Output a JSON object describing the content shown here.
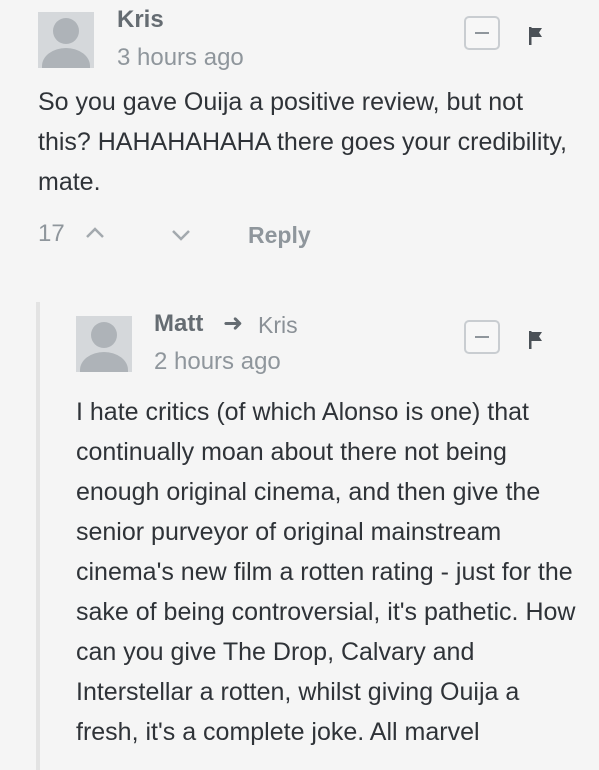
{
  "comments": [
    {
      "author": "Kris",
      "time": "3 hours ago",
      "body": "So you gave Ouija a positive review, but not this? HAHAHAHAHA there goes your credibility, mate.",
      "votes": "17",
      "reply_label": "Reply"
    },
    {
      "author": "Matt",
      "reply_to": "Kris",
      "time": "2 hours ago",
      "body": "I hate critics (of which Alonso is one) that continually moan about there not being enough original cinema, and then give the senior purveyor of original mainstream cinema's new film a rotten rating - just for the sake of being controversial, it's pathetic. How can you give The Drop, Calvary and Interstellar a rotten, whilst giving Ouija a fresh, it's a complete joke. All marvel"
    }
  ],
  "icons": {
    "avatar": "default-avatar-icon",
    "collapse": "minus-icon",
    "flag": "flag-icon",
    "upvote": "chevron-up-icon",
    "downvote": "chevron-down-icon",
    "reply_arrow": "arrow-right-icon"
  },
  "colors": {
    "background": "#f5f5f5",
    "muted_text": "#8f969c",
    "body_text": "#2f3338"
  }
}
